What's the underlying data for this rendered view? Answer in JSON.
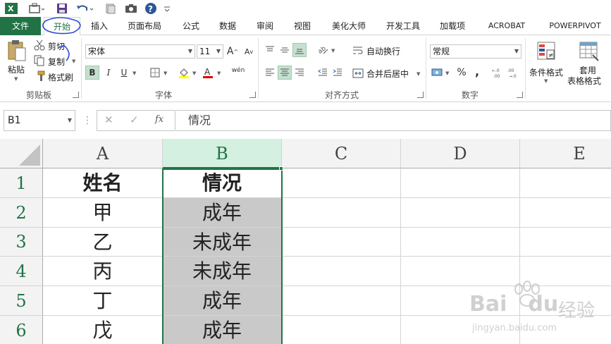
{
  "quick_access": {
    "items": [
      "excel-logo-icon",
      "touch-mode-icon",
      "save-icon",
      "undo-icon",
      "new-icon",
      "camera-icon",
      "help-icon",
      "customize-icon"
    ]
  },
  "tabs": [
    {
      "label": "文件"
    },
    {
      "label": "开始"
    },
    {
      "label": "插入"
    },
    {
      "label": "页面布局"
    },
    {
      "label": "公式"
    },
    {
      "label": "数据"
    },
    {
      "label": "审阅"
    },
    {
      "label": "视图"
    },
    {
      "label": "美化大师"
    },
    {
      "label": "开发工具"
    },
    {
      "label": "加载项"
    },
    {
      "label": "ACROBAT"
    },
    {
      "label": "POWERPIVOT"
    }
  ],
  "ribbon": {
    "clipboard": {
      "paste": "粘贴",
      "cut": "剪切",
      "copy": "复制",
      "format_painter": "格式刷",
      "label": "剪贴板"
    },
    "font": {
      "font_name": "宋体",
      "font_size": "11",
      "grow": "A",
      "shrink": "A",
      "bold": "B",
      "italic": "I",
      "underline": "U",
      "phonetic": "wén",
      "label": "字体"
    },
    "alignment": {
      "wrap_text": "自动换行",
      "merge_center": "合并后居中",
      "label": "对齐方式"
    },
    "number": {
      "format": "常规",
      "percent": "%",
      "comma": ",",
      "label": "数字"
    },
    "styles": {
      "conditional": "条件格式",
      "table_line1": "套用",
      "table_line2": "表格格式"
    }
  },
  "formula_bar": {
    "name_box": "B1",
    "cancel": "✕",
    "confirm": "✓",
    "fx": "fx",
    "content": "情况"
  },
  "sheet": {
    "columns": [
      "A",
      "B",
      "C",
      "D",
      "E"
    ],
    "rows": [
      "1",
      "2",
      "3",
      "4",
      "5",
      "6"
    ],
    "cells": [
      [
        "姓名",
        "情况"
      ],
      [
        "甲",
        "成年"
      ],
      [
        "乙",
        "未成年"
      ],
      [
        "丙",
        "未成年"
      ],
      [
        "丁",
        "成年"
      ],
      [
        "戊",
        "成年"
      ]
    ],
    "selected_column": "B"
  },
  "watermark": {
    "brand": "Bai",
    "brand2": "du",
    "brand_cn": "经验",
    "url": "jingyan.baidu.com"
  },
  "colors": {
    "accent": "#217346",
    "cell_fill": "#c9c9c9",
    "annotation": "#2a4bd0"
  }
}
